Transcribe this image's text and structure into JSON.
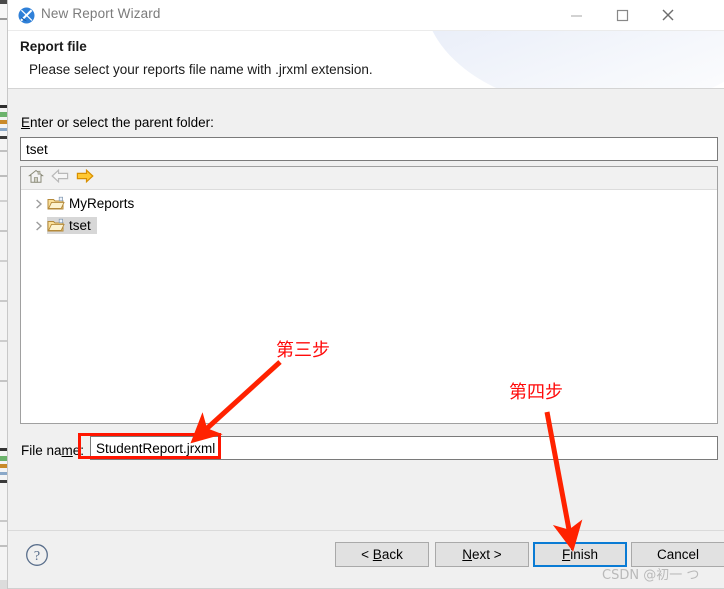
{
  "window": {
    "title": "New Report Wizard",
    "icon": "jasperreports-wizard-icon",
    "controls": {
      "minimize": "minimize-icon",
      "maximize": "maximize-icon",
      "close": "close-icon"
    }
  },
  "header": {
    "title": "Report file",
    "subtitle": "Please select your reports file name with .jrxml extension."
  },
  "form": {
    "parent_folder_label_pre": "E",
    "parent_folder_label_post": "nter or select the parent folder:",
    "parent_folder_value": "tset",
    "parent_folder_placeholder": "",
    "file_name_label_pre": "File na",
    "file_name_label_mid": "m",
    "file_name_label_post": "e:",
    "file_name_value": "StudentReport.jrxml",
    "file_name_placeholder": ""
  },
  "tree": {
    "toolbar": {
      "home": "home-icon",
      "back": "back-arrow-icon",
      "forward": "forward-arrow-icon"
    },
    "items": [
      {
        "label": "MyReports",
        "selected": false,
        "expandable": true,
        "icon": "folder-icon"
      },
      {
        "label": "tset",
        "selected": true,
        "expandable": true,
        "icon": "folder-icon"
      }
    ]
  },
  "footer": {
    "help": "help-icon",
    "buttons": [
      {
        "name": "back-button",
        "pre": "< ",
        "key": "B",
        "post": "ack",
        "focused": false
      },
      {
        "name": "next-button",
        "pre": "",
        "key": "N",
        "post": "ext >",
        "focused": false
      },
      {
        "name": "finish-button",
        "pre": "",
        "key": "F",
        "post": "inish",
        "focused": true
      },
      {
        "name": "cancel-button",
        "pre": "",
        "key": "",
        "post": "Cancel",
        "focused": false
      }
    ],
    "back_label": "< Back",
    "next_label": "Next >",
    "finish_label": "Finish",
    "cancel_label": "Cancel"
  },
  "annotations": {
    "step3": "第三步",
    "step4": "第四步",
    "highlight_color": "#ff1500",
    "arrow_color": "#ff2200"
  },
  "watermark": "CSDN @初一 つ",
  "colors": {
    "focus_blue": "#0a7bd4",
    "dialog_bg": "#f0f0f0",
    "selection_gray": "#d7d7d7",
    "annotation_red": "#ff0a0a"
  }
}
